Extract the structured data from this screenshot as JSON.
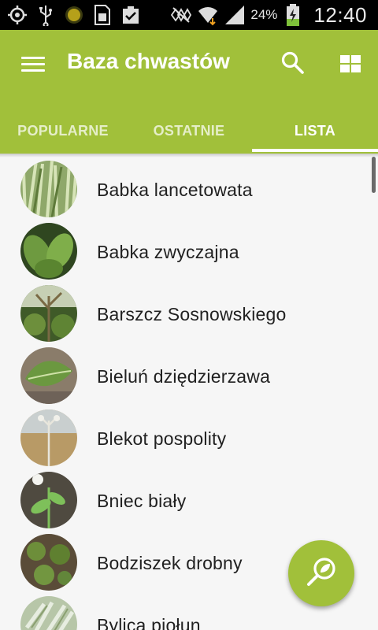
{
  "status_bar": {
    "icons": [
      "gps-icon",
      "usb-icon",
      "notification-icon",
      "sim-icon",
      "clipboard-icon",
      "mute-icon",
      "wifi-icon",
      "signal-icon",
      "battery-charging-icon"
    ],
    "battery_percent": "24%",
    "time": "12:40"
  },
  "appbar": {
    "title": "Baza chwastów",
    "color": "#a1c03a",
    "actions": [
      "search-icon",
      "grid-view-icon"
    ]
  },
  "tabs": [
    {
      "label": "POPULARNE",
      "active": false
    },
    {
      "label": "OSTATNIE",
      "active": false
    },
    {
      "label": "LISTA",
      "active": true
    }
  ],
  "weeds": [
    {
      "name": "Babka lancetowata"
    },
    {
      "name": "Babka zwyczajna"
    },
    {
      "name": "Barszcz Sosnowskiego"
    },
    {
      "name": "Bieluń dziędzierzawa"
    },
    {
      "name": "Blekot pospolity"
    },
    {
      "name": "Bniec biały"
    },
    {
      "name": "Bodziszek drobny"
    },
    {
      "name": "Bylica piołun"
    }
  ],
  "fab": {
    "icon": "leaf-search-icon"
  }
}
